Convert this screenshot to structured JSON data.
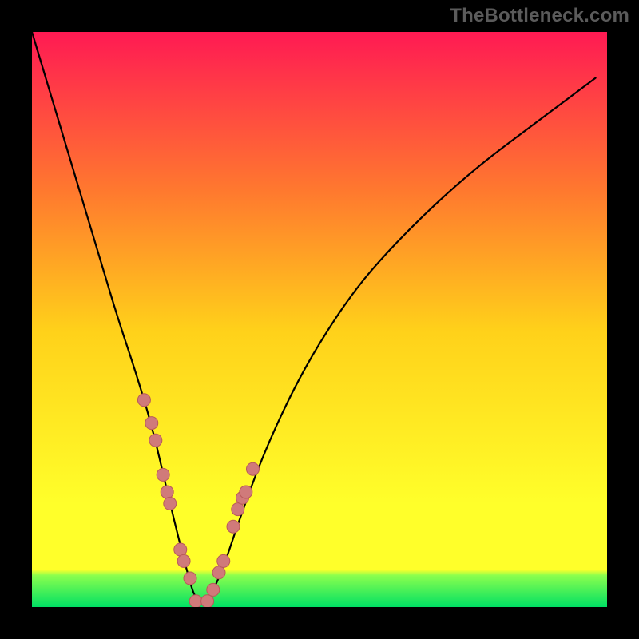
{
  "watermark": "TheBottleneck.com",
  "colors": {
    "frame": "#000000",
    "curve": "#000000",
    "markers_fill": "#d07a7a",
    "markers_stroke": "#b85a5a",
    "gradient_top": "#ff1a53",
    "gradient_mid_upper": "#ff7a2e",
    "gradient_mid": "#ffd11a",
    "gradient_mid_lower": "#ffff2a",
    "gradient_band": "#8bff4d",
    "gradient_bottom": "#00e064"
  },
  "chart_data": {
    "type": "line",
    "title": "",
    "xlabel": "",
    "ylabel": "",
    "xlim": [
      0,
      100
    ],
    "ylim": [
      0,
      100
    ],
    "grid": false,
    "legend": false,
    "series": [
      {
        "name": "bottleneck-curve",
        "x": [
          0,
          3,
          6,
          9,
          12,
          15,
          18,
          21,
          24,
          27,
          28.5,
          30.5,
          33,
          36,
          40,
          45,
          50,
          56,
          62,
          70,
          78,
          86,
          94,
          98
        ],
        "y": [
          100,
          90,
          80,
          70,
          60,
          50,
          41,
          31,
          18,
          6,
          1,
          1,
          6,
          15,
          26,
          37,
          46,
          55,
          62,
          70,
          77,
          83,
          89,
          92
        ]
      }
    ],
    "markers": {
      "name": "highlighted-points",
      "x": [
        19.5,
        20.8,
        21.5,
        22.8,
        23.5,
        24.0,
        25.8,
        26.4,
        27.5,
        28.5,
        30.5,
        31.5,
        32.5,
        33.3,
        35.0,
        35.8,
        36.6,
        37.2,
        38.4
      ],
      "y": [
        36,
        32,
        29,
        23,
        20,
        18,
        10,
        8,
        5,
        1,
        1,
        3,
        6,
        8,
        14,
        17,
        19,
        20,
        24
      ]
    }
  }
}
